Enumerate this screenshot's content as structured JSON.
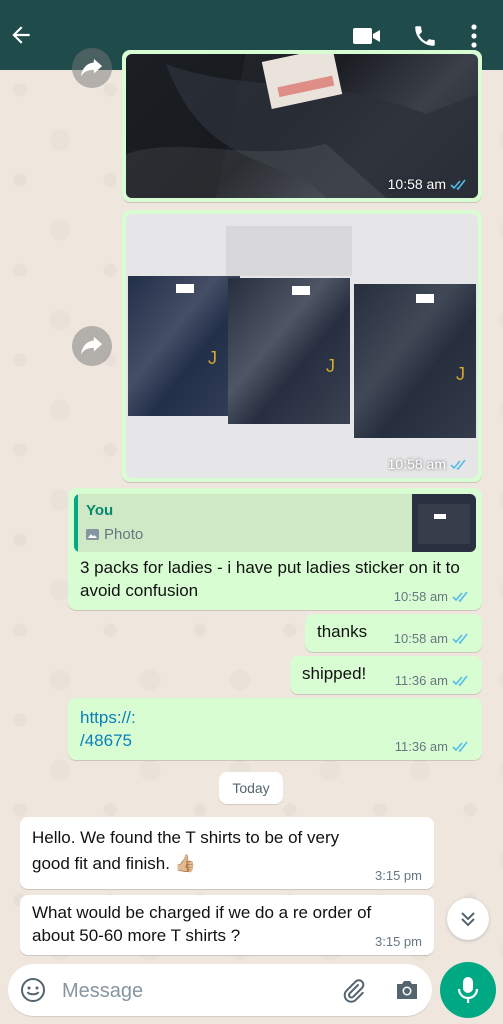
{
  "header": {
    "back_icon": "arrow-left-icon",
    "video_icon": "video-camera-icon",
    "call_icon": "phone-icon",
    "menu_icon": "more-vertical-icon",
    "bg_color": "#1f4b4a"
  },
  "messages": {
    "image1": {
      "time": "10:58 am"
    },
    "image2": {
      "time": "10:58 am"
    },
    "reply": {
      "quote_author": "You",
      "quote_type": "Photo",
      "text": "3 packs for ladies - i have put ladies sticker on it to avoid confusion",
      "time": "10:58 am"
    },
    "thanks": {
      "text": "thanks",
      "time": "10:58 am"
    },
    "shipped": {
      "text": "shipped!",
      "time": "11:36 am"
    },
    "link": {
      "line1": "https://:",
      "line2": "/48675",
      "time": "11:36 am"
    },
    "date_divider": "Today",
    "incoming1": {
      "text": "Hello. We found the  T shirts to be of very good fit and finish. 👍🏼",
      "time": "3:15 pm"
    },
    "incoming2": {
      "text": "What would be charged if we do a re order of about 50-60 more T shirts ?",
      "time": "3:15 pm"
    }
  },
  "composer": {
    "placeholder": "Message",
    "emoji_icon": "emoji-icon",
    "attach_icon": "paperclip-icon",
    "camera_icon": "camera-icon",
    "mic_icon": "microphone-icon",
    "accent": "#00a884"
  },
  "colors": {
    "outgoing_bubble": "#d9fdd3",
    "incoming_bubble": "#ffffff",
    "read_ticks": "#53bdeb"
  }
}
